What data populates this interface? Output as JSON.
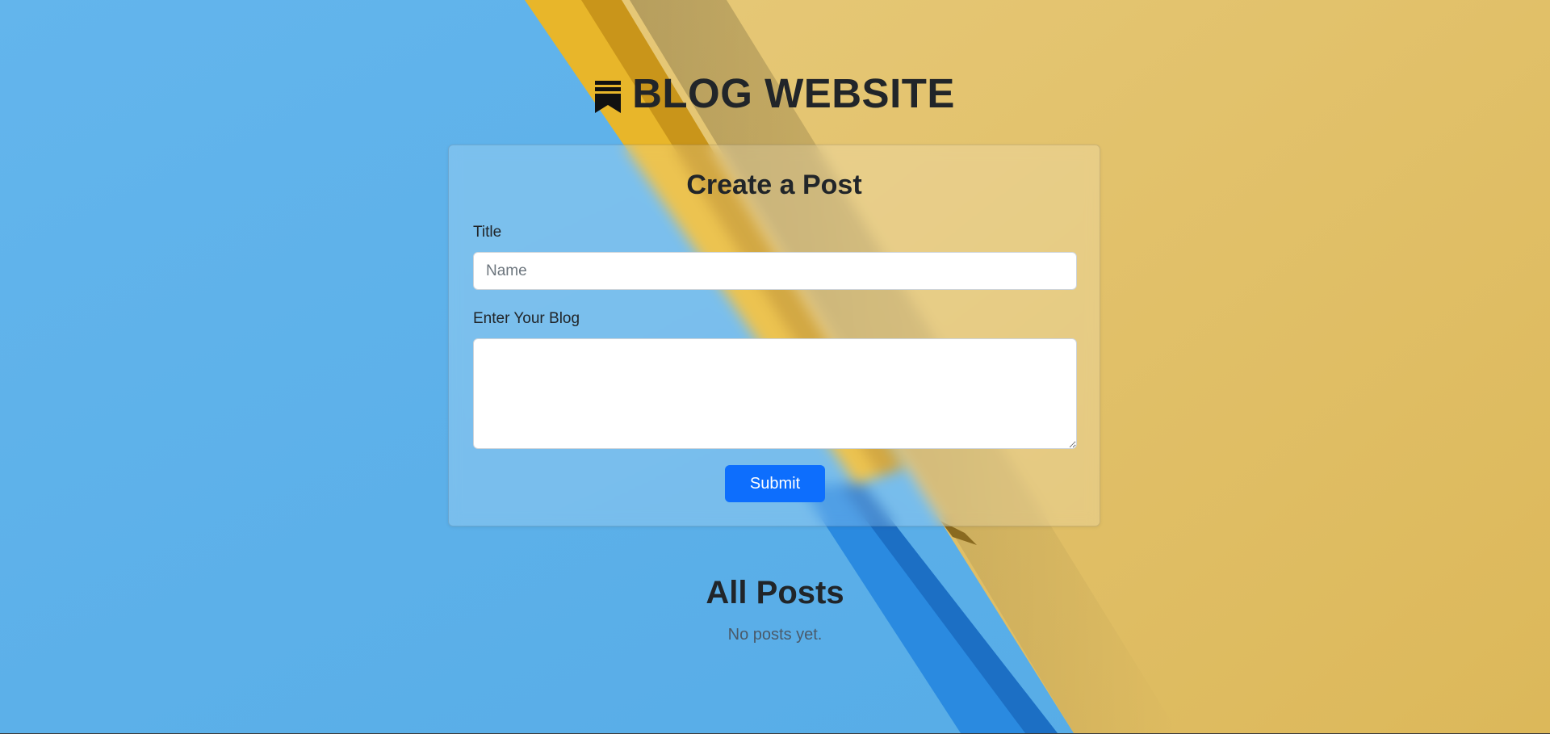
{
  "header": {
    "title": "BLOG WEBSITE",
    "icon": "bookmark-icon"
  },
  "form": {
    "heading": "Create a Post",
    "title_label": "Title",
    "title_placeholder": "Name",
    "title_value": "",
    "blog_label": "Enter Your Blog",
    "blog_value": "",
    "submit_label": "Submit"
  },
  "posts": {
    "heading": "All Posts",
    "empty_message": "No posts yet."
  },
  "colors": {
    "background_blue": "#5cb1ea",
    "background_yellow": "#e3c46c",
    "primary": "#0d6efd"
  }
}
